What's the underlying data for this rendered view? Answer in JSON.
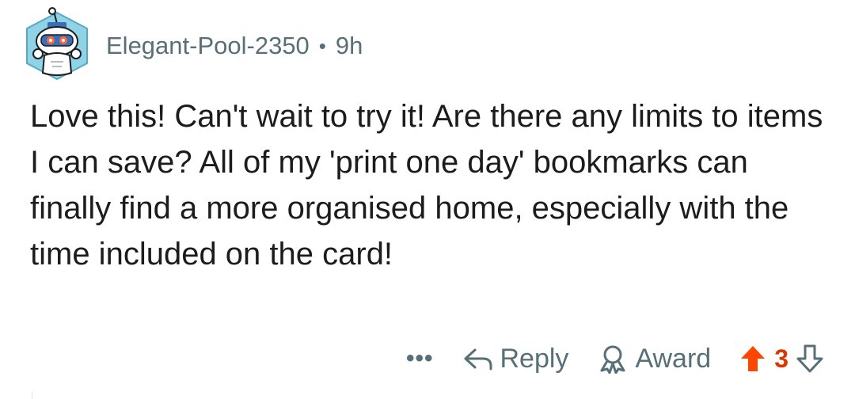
{
  "comment": {
    "author": "Elegant-Pool-2350",
    "separator": "•",
    "age": "9h",
    "body": "Love this! Can't wait to try it! Are there any limits to items I can save? All of my 'print one day' bookmarks can finally find a more organised home, especially with the time included on the card!"
  },
  "actions": {
    "more": "•••",
    "reply": "Reply",
    "award": "Award",
    "score": "3"
  },
  "icons": {
    "avatar": "snoo-avatar-icon",
    "reply": "reply-arrow-icon",
    "award": "award-ribbon-icon",
    "upvote": "upvote-arrow-icon",
    "downvote": "downvote-arrow-icon"
  },
  "colors": {
    "upvote": "#ff4500",
    "score": "#d93900",
    "meta": "#576f76",
    "avatar_bg": "#8fd3e6"
  }
}
